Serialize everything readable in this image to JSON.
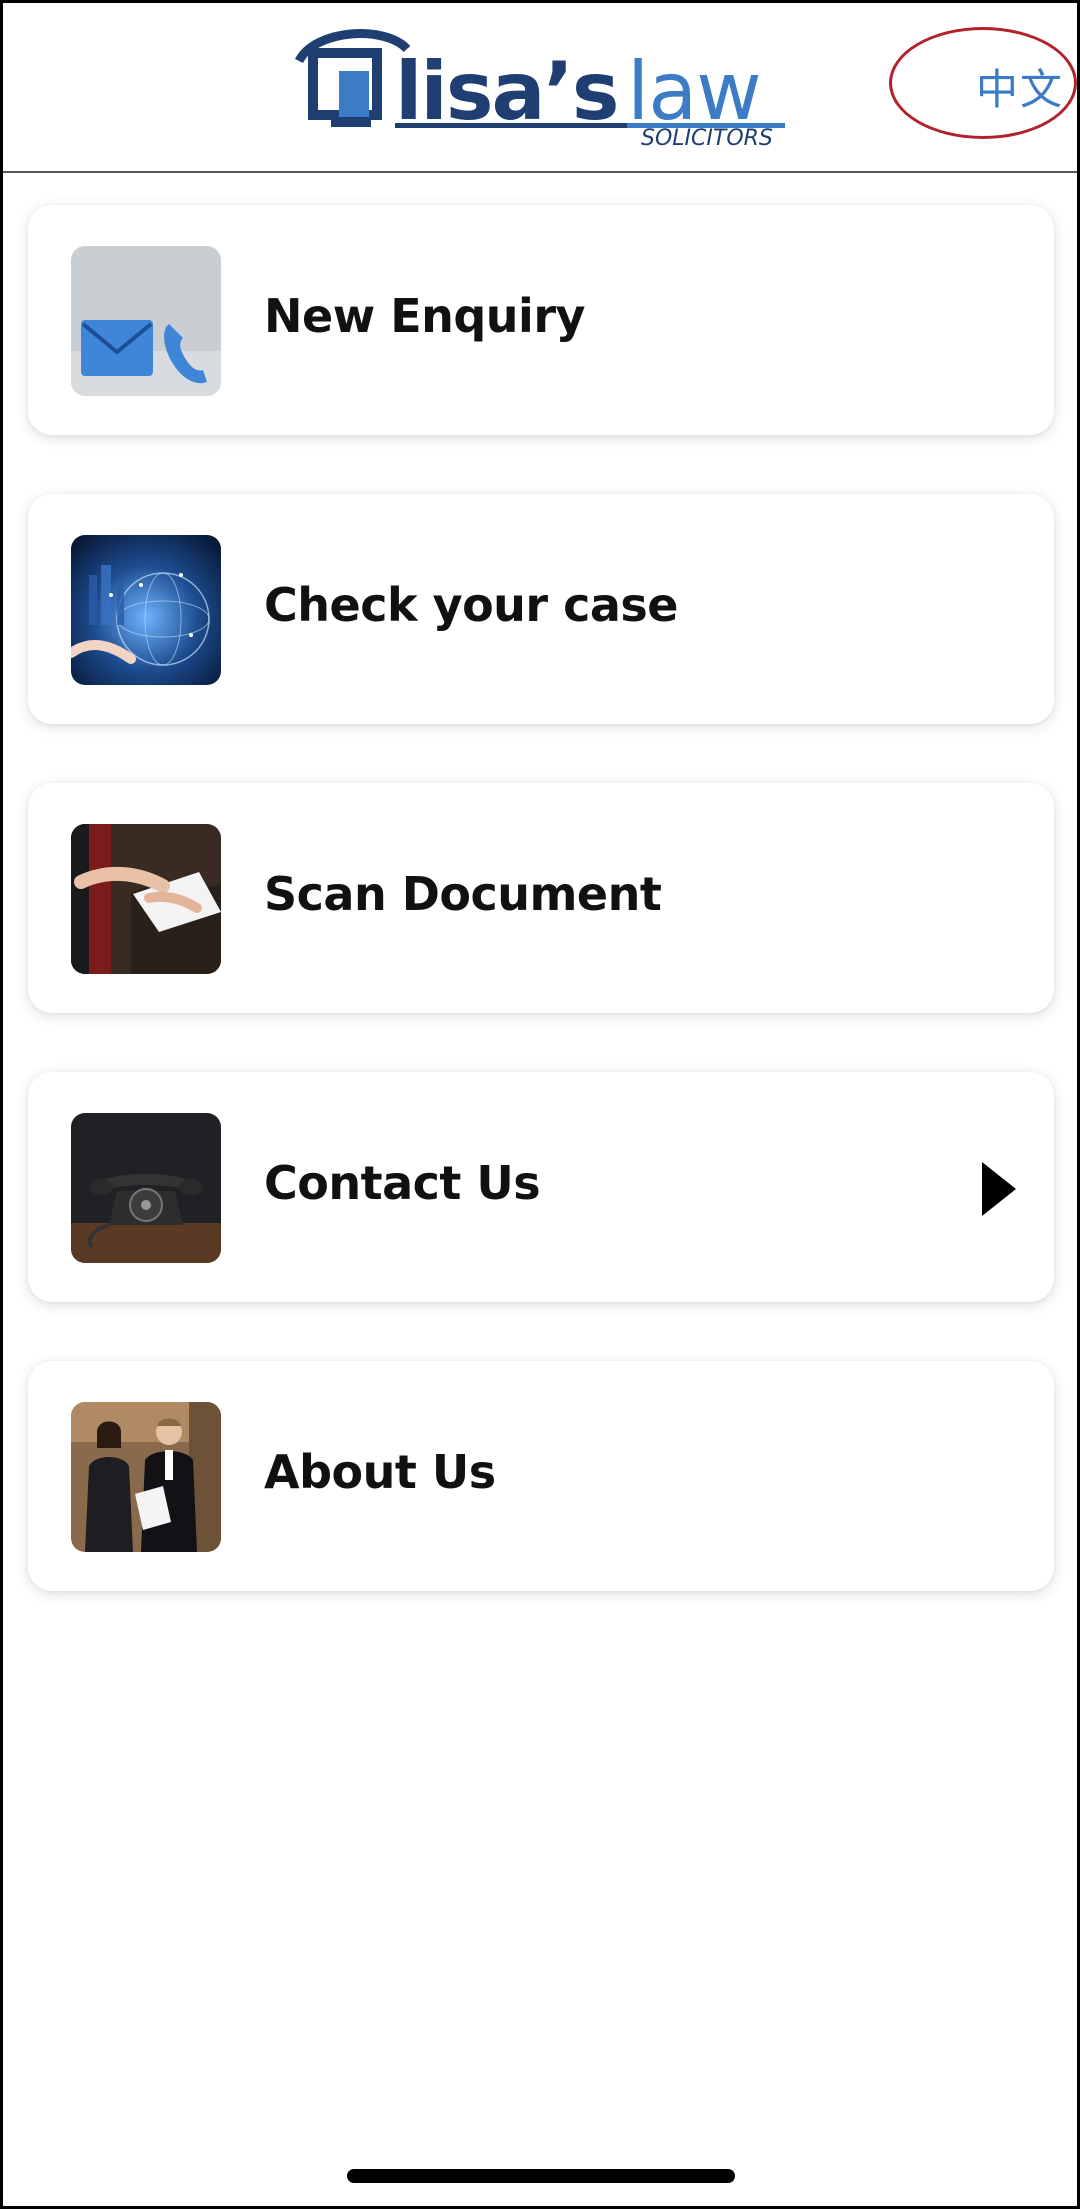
{
  "header": {
    "logo": {
      "name": "lisas-law-logo",
      "wordmark": "LISA'S LAW",
      "subtitle": "SOLICITORS"
    },
    "language_toggle": "中文"
  },
  "menu": {
    "items": [
      {
        "label": "New Enquiry",
        "icon": "mail-phone-icon"
      },
      {
        "label": "Check your case",
        "icon": "globe-network-icon"
      },
      {
        "label": "Scan Document",
        "icon": "document-hands-icon"
      },
      {
        "label": "Contact Us",
        "icon": "rotary-phone-icon",
        "has_arrow": true
      },
      {
        "label": "About Us",
        "icon": "lawyers-icon"
      }
    ]
  },
  "colors": {
    "brand_blue": "#3c7bc6",
    "brand_navy": "#1f3f73",
    "toggle_ring": "#b1222c"
  }
}
